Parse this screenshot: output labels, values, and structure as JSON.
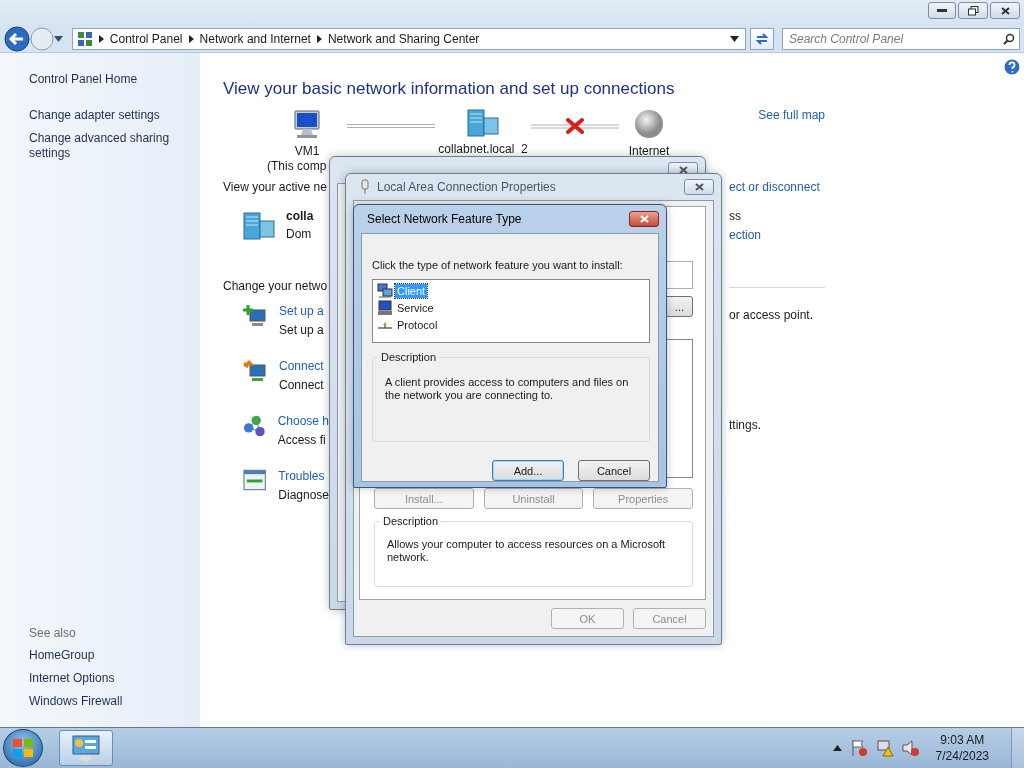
{
  "address_bar": {
    "breadcrumbs": [
      "Control Panel",
      "Network and Internet",
      "Network and Sharing Center"
    ]
  },
  "search": {
    "placeholder": "Search Control Panel"
  },
  "sidebar": {
    "items": [
      "Control Panel Home",
      "Change adapter settings",
      "Change advanced sharing settings"
    ],
    "see_also": {
      "title": "See also",
      "items": [
        "HomeGroup",
        "Internet Options",
        "Windows Firewall"
      ]
    }
  },
  "main": {
    "heading": "View your basic network information and set up connections",
    "map": {
      "nodes": [
        {
          "kind": "computer",
          "label": "VM1",
          "sublabel": "(This comp"
        },
        {
          "kind": "domain",
          "label": "collabnet.local  2"
        },
        {
          "kind": "internet",
          "label": "Internet"
        }
      ],
      "links": [
        {
          "broken": false
        },
        {
          "broken": true
        }
      ],
      "full_map_link": "See full map"
    },
    "active_networks": {
      "label": "View your active ne",
      "link": "ect or disconnect"
    },
    "network": {
      "name": "colla",
      "category": "Dom",
      "access": "ss",
      "connection": "ection"
    },
    "change_settings": {
      "label": "Change your netwo"
    },
    "tasks": [
      {
        "kind": "setup",
        "title": "Set up a",
        "description": "Set up a",
        "tail": "or access point."
      },
      {
        "kind": "connect",
        "title": "Connect",
        "description": "Connect"
      },
      {
        "kind": "homegroup",
        "title": "Choose h",
        "description": "Access fi",
        "tail": "ttings."
      },
      {
        "kind": "troubleshoot",
        "title": "Troubles",
        "description": "Diagnose"
      }
    ]
  },
  "properties_dialog": {
    "title": "Local Area Connection Properties",
    "configure_fragment": "...",
    "item_buttons": [
      {
        "label": "Install...",
        "disabled": true
      },
      {
        "label": "Uninstall",
        "disabled": true
      },
      {
        "label": "Properties",
        "disabled": true
      }
    ],
    "description": {
      "title": "Description",
      "text": "Allows your computer to access resources on a Microsoft network."
    },
    "footer_buttons": [
      {
        "label": "OK",
        "disabled": true
      },
      {
        "label": "Cancel",
        "disabled": true
      }
    ]
  },
  "feature_dialog": {
    "title": "Select Network Feature Type",
    "instruction": "Click the type of network feature you want to install:",
    "features": [
      {
        "kind": "client",
        "label": "Client",
        "selected": true
      },
      {
        "kind": "service",
        "label": "Service",
        "selected": false
      },
      {
        "kind": "protocol",
        "label": "Protocol",
        "selected": false
      }
    ],
    "description": {
      "title": "Description",
      "text": "A client provides access to computers and files on the network you are connecting to."
    },
    "buttons": [
      {
        "label": "Add...",
        "default": true
      },
      {
        "label": "Cancel",
        "default": false
      }
    ]
  },
  "taskbar": {
    "time": "9:03 AM",
    "date": "7/24/2023"
  }
}
